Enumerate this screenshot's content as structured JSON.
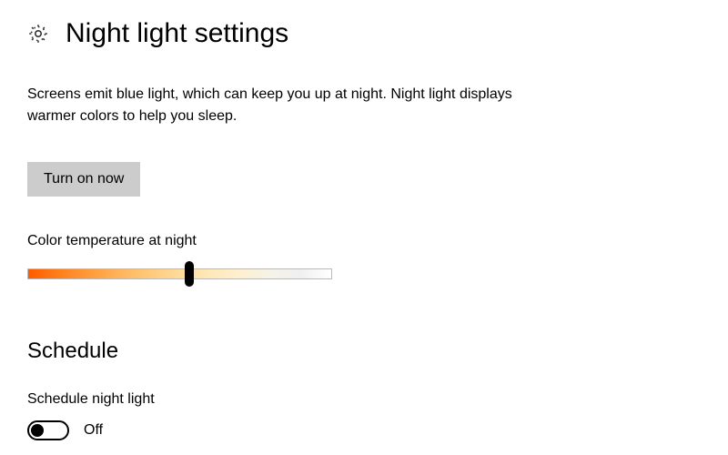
{
  "header": {
    "title": "Night light settings",
    "icon": "gear-icon"
  },
  "description": "Screens emit blue light, which can keep you up at night. Night light displays warmer colors to help you sleep.",
  "actions": {
    "turn_on_label": "Turn on now"
  },
  "slider": {
    "label": "Color temperature at night",
    "value_percent": 53
  },
  "schedule": {
    "heading": "Schedule",
    "toggle_label": "Schedule night light",
    "toggle_state": "Off",
    "toggle_on": false
  }
}
